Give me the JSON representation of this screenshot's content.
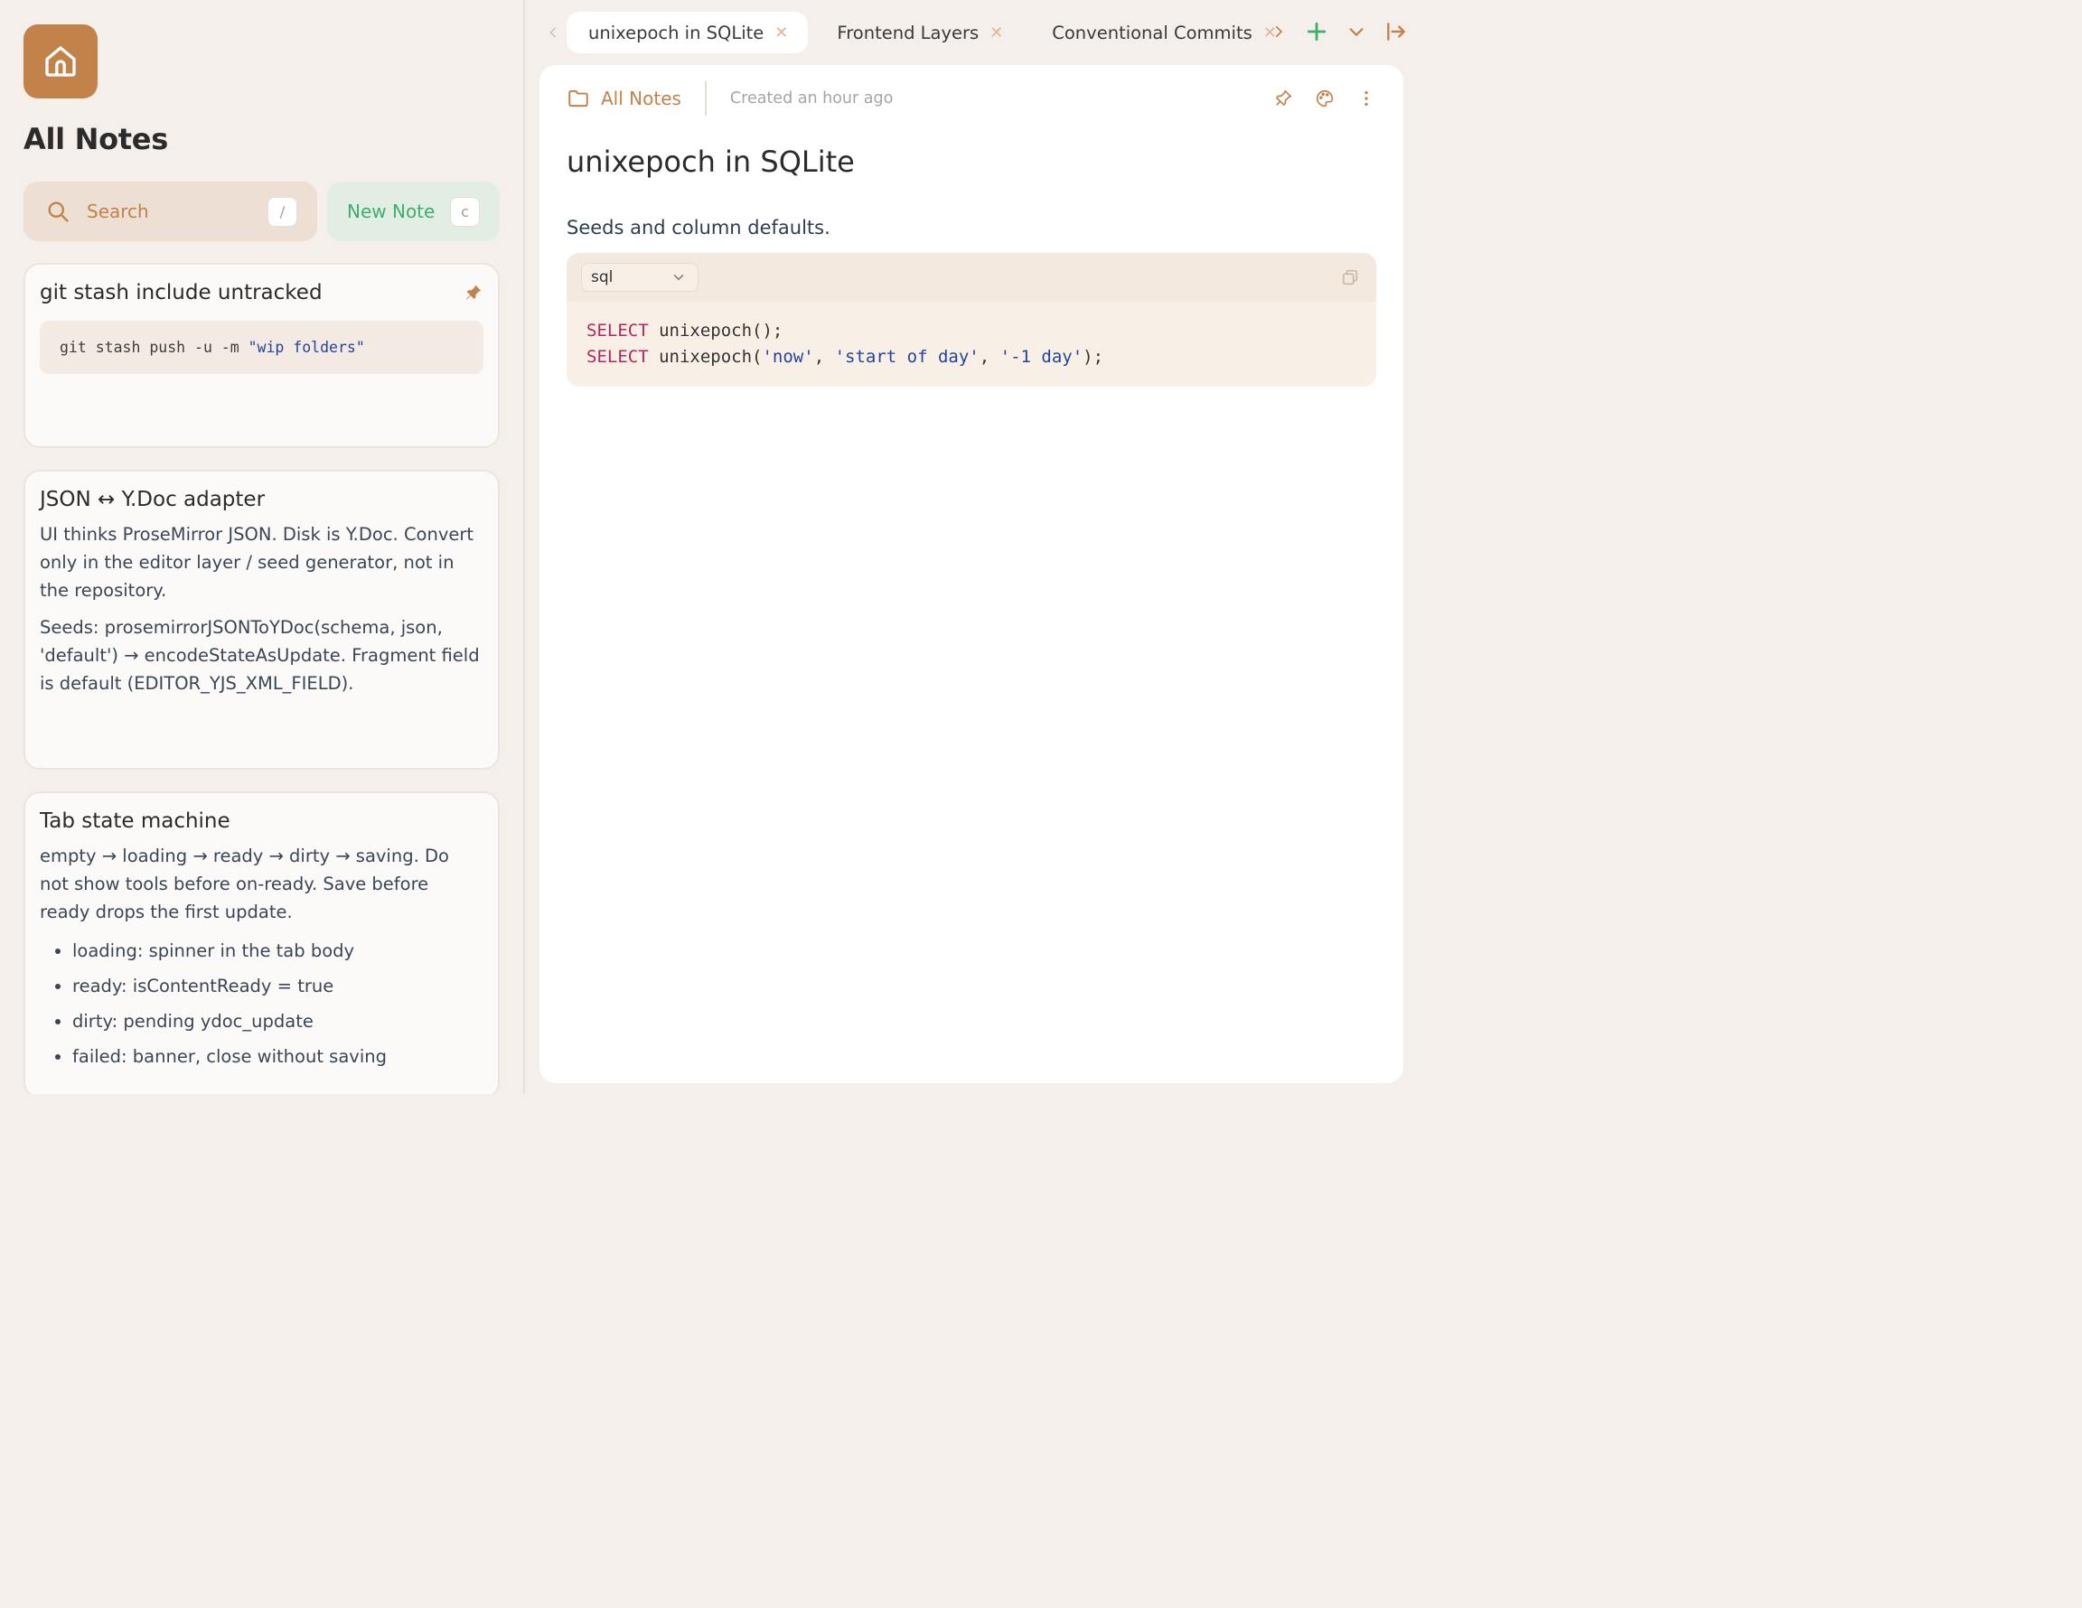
{
  "sidebar": {
    "title": "All Notes",
    "search": {
      "label": "Search",
      "shortcut": "/"
    },
    "new_note": {
      "label": "New Note",
      "shortcut": "c"
    },
    "notes": [
      {
        "title": "git stash include untracked",
        "pinned": true,
        "code": {
          "plain": "git stash push -u -m ",
          "string": "\"wip folders\""
        }
      },
      {
        "title": "JSON ↔ Y.Doc adapter",
        "paragraphs": [
          "UI thinks ProseMirror JSON. Disk is Y.Doc. Convert only in the editor layer / seed generator, not in the repository.",
          "Seeds: prosemirrorJSONToYDoc(schema, json, 'default') → encodeStateAsUpdate. Fragment field is default (EDITOR_YJS_XML_FIELD)."
        ]
      },
      {
        "title": "Tab state machine",
        "paragraphs": [
          "empty → loading → ready → dirty → saving. Do not show tools before on-ready. Save before ready drops the first update."
        ],
        "bullets": [
          "loading: spinner in the tab body",
          "ready: isContentReady = true",
          "dirty: pending ydoc_update",
          "failed: banner, close without saving"
        ]
      }
    ]
  },
  "tabs": [
    {
      "label": "unixepoch in SQLite",
      "active": true
    },
    {
      "label": "Frontend Layers",
      "active": false
    },
    {
      "label": "Conventional Commits",
      "active": false
    }
  ],
  "note": {
    "breadcrumb": "All Notes",
    "created": "Created an hour ago",
    "title": "unixepoch in SQLite",
    "paragraph": "Seeds and column defaults.",
    "code": {
      "language": "sql",
      "line1": {
        "kw": "SELECT",
        "rest": " unixepoch();"
      },
      "line2": {
        "kw": "SELECT",
        "fn": " unixepoch(",
        "s1": "'now'",
        "sep1": ", ",
        "s2": "'start of day'",
        "sep2": ", ",
        "s3": "'-1 day'",
        "end": ");"
      }
    }
  },
  "colors": {
    "accent": "#c2824a",
    "green": "#3fae6b",
    "background": "#f4efea",
    "keyword": "#b4265c",
    "string": "#23449a"
  },
  "icons": [
    "home-icon",
    "search-icon",
    "pin-filled-icon",
    "chevron-left-icon",
    "tab-close-icon",
    "chevron-right-icon",
    "plus-icon",
    "chevron-down-icon",
    "collapse-panel-icon",
    "folder-icon",
    "pin-icon",
    "palette-icon",
    "more-vertical-icon",
    "copy-icon"
  ]
}
